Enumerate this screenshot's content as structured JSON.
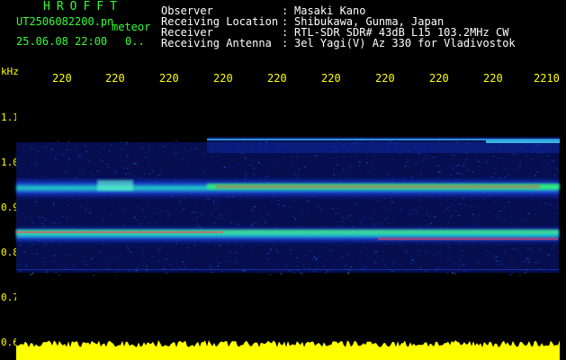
{
  "header": {
    "app_title": "HROFFT",
    "filename": "UT2506082200.pn",
    "mode": "meteor",
    "datetime": "25.06.08 22:00",
    "status": "0..",
    "rows": [
      {
        "label": "Observer",
        "value": "Masaki Kano"
      },
      {
        "label": "Receiving Location",
        "value": "Shibukawa, Gunma, Japan"
      },
      {
        "label": "Receiver",
        "value": "RTL-SDR SDR# 43dB L15 103.2MHz CW"
      },
      {
        "label": "Receiving Antenna",
        "value": "3el Yagi(V) Az 330 for Vladivostok"
      }
    ]
  },
  "axes": {
    "y_unit": "kHz",
    "x_ticks": [
      "220",
      "220",
      "220",
      "220",
      "220",
      "220",
      "220",
      "220",
      "220",
      "2210"
    ],
    "y_ticks": [
      "1.1",
      "1.0",
      "0.9",
      "0.8",
      "0.7",
      "0.6"
    ]
  },
  "colors": {
    "label_green": "#33ff33",
    "text_white": "#ffffff",
    "axis_yellow": "#ffff00",
    "background": "#000000"
  }
}
